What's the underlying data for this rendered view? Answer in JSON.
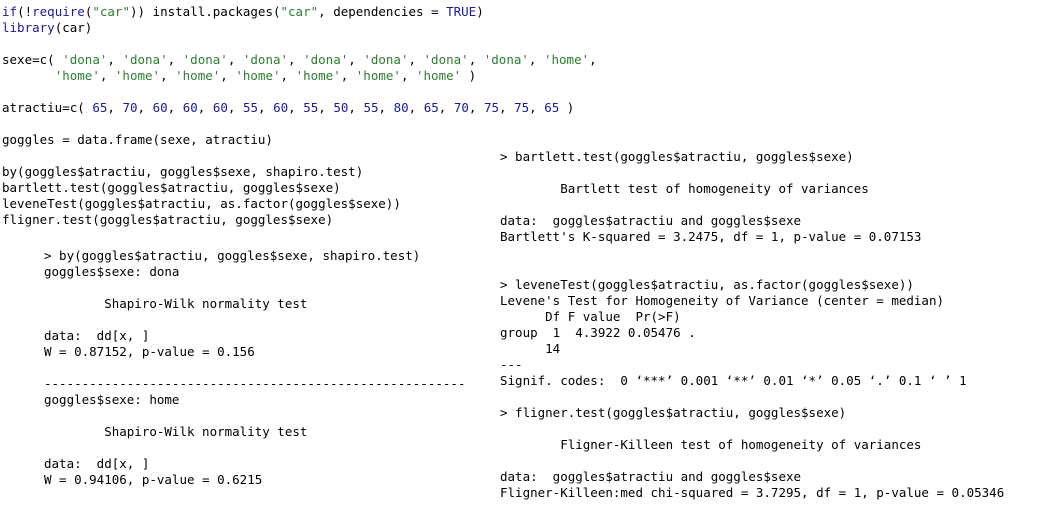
{
  "script": {
    "lines": [
      [
        {
          "t": "if",
          "c": "kw"
        },
        {
          "t": "(!",
          "c": "plain"
        },
        {
          "t": "require",
          "c": "kw"
        },
        {
          "t": "(",
          "c": "plain"
        },
        {
          "t": "\"car\"",
          "c": "str"
        },
        {
          "t": ")) install.packages(",
          "c": "plain"
        },
        {
          "t": "\"car\"",
          "c": "str"
        },
        {
          "t": ", dependencies = ",
          "c": "plain"
        },
        {
          "t": "TRUE",
          "c": "kw"
        },
        {
          "t": ")",
          "c": "plain"
        }
      ],
      [
        {
          "t": "library",
          "c": "kw"
        },
        {
          "t": "(car)",
          "c": "plain"
        }
      ],
      [],
      [
        {
          "t": "sexe=c( ",
          "c": "plain"
        },
        {
          "t": "'dona'",
          "c": "str"
        },
        {
          "t": ", ",
          "c": "plain"
        },
        {
          "t": "'dona'",
          "c": "str"
        },
        {
          "t": ", ",
          "c": "plain"
        },
        {
          "t": "'dona'",
          "c": "str"
        },
        {
          "t": ", ",
          "c": "plain"
        },
        {
          "t": "'dona'",
          "c": "str"
        },
        {
          "t": ", ",
          "c": "plain"
        },
        {
          "t": "'dona'",
          "c": "str"
        },
        {
          "t": ", ",
          "c": "plain"
        },
        {
          "t": "'dona'",
          "c": "str"
        },
        {
          "t": ", ",
          "c": "plain"
        },
        {
          "t": "'dona'",
          "c": "str"
        },
        {
          "t": ", ",
          "c": "plain"
        },
        {
          "t": "'dona'",
          "c": "str"
        },
        {
          "t": ", ",
          "c": "plain"
        },
        {
          "t": "'home'",
          "c": "str"
        },
        {
          "t": ",",
          "c": "plain"
        }
      ],
      [
        {
          "t": "       ",
          "c": "plain"
        },
        {
          "t": "'home'",
          "c": "str"
        },
        {
          "t": ", ",
          "c": "plain"
        },
        {
          "t": "'home'",
          "c": "str"
        },
        {
          "t": ", ",
          "c": "plain"
        },
        {
          "t": "'home'",
          "c": "str"
        },
        {
          "t": ", ",
          "c": "plain"
        },
        {
          "t": "'home'",
          "c": "str"
        },
        {
          "t": ", ",
          "c": "plain"
        },
        {
          "t": "'home'",
          "c": "str"
        },
        {
          "t": ", ",
          "c": "plain"
        },
        {
          "t": "'home'",
          "c": "str"
        },
        {
          "t": ", ",
          "c": "plain"
        },
        {
          "t": "'home'",
          "c": "str"
        },
        {
          "t": " )",
          "c": "plain"
        }
      ],
      [],
      [
        {
          "t": "atractiu=c( ",
          "c": "plain"
        },
        {
          "t": "65",
          "c": "num"
        },
        {
          "t": ", ",
          "c": "plain"
        },
        {
          "t": "70",
          "c": "num"
        },
        {
          "t": ", ",
          "c": "plain"
        },
        {
          "t": "60",
          "c": "num"
        },
        {
          "t": ", ",
          "c": "plain"
        },
        {
          "t": "60",
          "c": "num"
        },
        {
          "t": ", ",
          "c": "plain"
        },
        {
          "t": "60",
          "c": "num"
        },
        {
          "t": ", ",
          "c": "plain"
        },
        {
          "t": "55",
          "c": "num"
        },
        {
          "t": ", ",
          "c": "plain"
        },
        {
          "t": "60",
          "c": "num"
        },
        {
          "t": ", ",
          "c": "plain"
        },
        {
          "t": "55",
          "c": "num"
        },
        {
          "t": ", ",
          "c": "plain"
        },
        {
          "t": "50",
          "c": "num"
        },
        {
          "t": ", ",
          "c": "plain"
        },
        {
          "t": "55",
          "c": "num"
        },
        {
          "t": ", ",
          "c": "plain"
        },
        {
          "t": "80",
          "c": "num"
        },
        {
          "t": ", ",
          "c": "plain"
        },
        {
          "t": "65",
          "c": "num"
        },
        {
          "t": ", ",
          "c": "plain"
        },
        {
          "t": "70",
          "c": "num"
        },
        {
          "t": ", ",
          "c": "plain"
        },
        {
          "t": "75",
          "c": "num"
        },
        {
          "t": ", ",
          "c": "plain"
        },
        {
          "t": "75",
          "c": "num"
        },
        {
          "t": ", ",
          "c": "plain"
        },
        {
          "t": "65",
          "c": "num"
        },
        {
          "t": " )",
          "c": "plain"
        }
      ],
      [],
      [
        {
          "t": "goggles = data.frame(sexe, atractiu)",
          "c": "plain"
        }
      ],
      [],
      [
        {
          "t": "by(goggles$atractiu, goggles$sexe, shapiro.test)",
          "c": "plain"
        }
      ],
      [
        {
          "t": "bartlett.test(goggles$atractiu, goggles$sexe)",
          "c": "plain"
        }
      ],
      [
        {
          "t": "leveneTest(goggles$atractiu, as.factor(goggles$sexe))",
          "c": "plain"
        }
      ],
      [
        {
          "t": "fligner.test(goggles$atractiu, goggles$sexe)",
          "c": "plain"
        }
      ]
    ]
  },
  "console_left": {
    "lines": [
      "> by(goggles$atractiu, goggles$sexe, shapiro.test)",
      "goggles$sexe: dona",
      "",
      "        Shapiro-Wilk normality test",
      "",
      "data:  dd[x, ]",
      "W = 0.87152, p-value = 0.156",
      "",
      "--------------------------------------------------------",
      "goggles$sexe: home",
      "",
      "        Shapiro-Wilk normality test",
      "",
      "data:  dd[x, ]",
      "W = 0.94106, p-value = 0.6215"
    ]
  },
  "console_right": {
    "lines": [
      "> bartlett.test(goggles$atractiu, goggles$sexe)",
      "",
      "        Bartlett test of homogeneity of variances",
      "",
      "data:  goggles$atractiu and goggles$sexe",
      "Bartlett's K-squared = 3.2475, df = 1, p-value = 0.07153",
      "",
      "",
      "> leveneTest(goggles$atractiu, as.factor(goggles$sexe))",
      "Levene's Test for Homogeneity of Variance (center = median)",
      "      Df F value  Pr(>F)",
      "group  1  4.3922 0.05476 .",
      "      14",
      "---",
      "Signif. codes:  0 ‘***’ 0.001 ‘**’ 0.01 ‘*’ 0.05 ‘.’ 0.1 ‘ ’ 1",
      "",
      "> fligner.test(goggles$atractiu, goggles$sexe)",
      "",
      "        Fligner-Killeen test of homogeneity of variances",
      "",
      "data:  goggles$atractiu and goggles$sexe",
      "Fligner-Killeen:med chi-squared = 3.7295, df = 1, p-value = 0.05346"
    ]
  },
  "colors": {
    "keyword": "#1a1a9c",
    "string": "#2e7d32",
    "number": "#1a1a9c",
    "text": "#000000",
    "background": "#ffffff"
  }
}
